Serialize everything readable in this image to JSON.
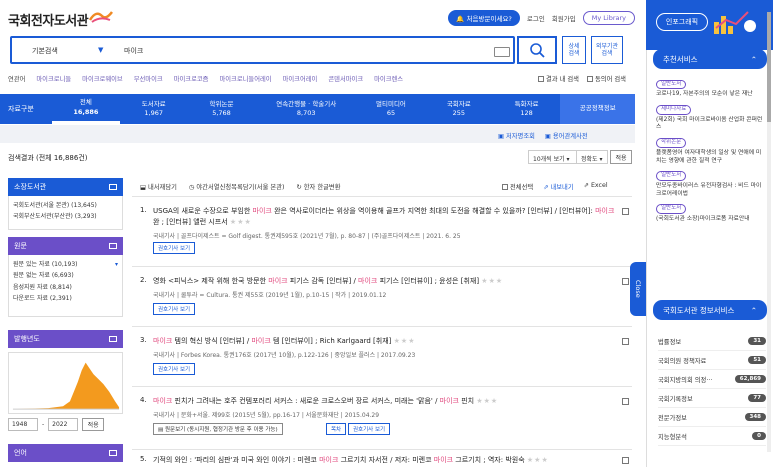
{
  "header": {
    "logo_text": "국회전자도서관",
    "first_visit": "처음방문이세요?",
    "login": "로그인",
    "signup": "회원가입",
    "my_library": "My Library"
  },
  "search": {
    "type": "기본검색",
    "query": "마이크",
    "detail_label": "상세\n검색",
    "external_label": "외부기관\n검색"
  },
  "related": {
    "label": "연관어",
    "terms": [
      "마이크로니들",
      "마이크로웨이브",
      "무선마이크",
      "마이크로코즘",
      "마이크로니들어레이",
      "마이크어레이",
      "콘덴서마이크",
      "마이크렌스"
    ],
    "within_results": "결과 내 검색",
    "synonyms": "동의어 검색"
  },
  "tabs": {
    "label": "자료구분",
    "items": [
      {
        "name": "전체",
        "count": "16,886"
      },
      {
        "name": "도서자료",
        "count": "1,967"
      },
      {
        "name": "학위논문",
        "count": "5,768"
      },
      {
        "name": "연속간행물 · 학술기사",
        "count": "8,703"
      },
      {
        "name": "멀티미디어",
        "count": "65"
      },
      {
        "name": "국회자료",
        "count": "255"
      },
      {
        "name": "특화자료",
        "count": "128"
      }
    ],
    "policy": "공공정책정보"
  },
  "sub_links": {
    "help": "저자명조회",
    "dict": "용어관계사전"
  },
  "results": {
    "title": "검색결과 (전체 16,886건)",
    "per_page": "10개씩 보기",
    "sort": "정확도",
    "apply": "적용",
    "tools": {
      "page": "내서재담기",
      "basket": "야간서열신청목록담기(서울 본관)",
      "convert": "한자 한글변환"
    },
    "tools_right": {
      "select_all": "전체선택",
      "save": "내보내기",
      "excel": "Excel"
    },
    "items": [
      {
        "num": "1.",
        "pre": "USGA의 새로운 수장으로 부임한 ",
        "hl1": "마이크",
        "mid": " 완은 역사로이더라는 위상을 역이용해 골프가 지역한 최대의 도전을 해결할 수 있을까? [인터뷰] / [인터뷰어]: ",
        "hl2": "마이크",
        "post": " 완 ; [인터뷰] 앨런 시프서",
        "stars": "★★★",
        "meta": "국내기사 | 골프다이제스트 = Golf digest. 통권제595호 (2021년 7월), p. 80-87 | (주)골프다이제스트 | 2021. 6. 25",
        "button": "권호기사 보기"
      },
      {
        "num": "2.",
        "pre": "영화 <피닉스> 제작 위해 한국 방문한 ",
        "hl1": "마이크",
        "mid": " 피기스 감독 [인터뷰] / ",
        "hl2": "마이크",
        "post": " 피기스 [인터뷰이] ; 윤성은 [취재]",
        "stars": "★★★",
        "meta": "국내기사 | 쿨투라 = Cultura. 통권 제55호 (2019년 1월), p.10-15 | 작가 | 2019.01.12",
        "button": "권호기사 보기"
      },
      {
        "num": "3.",
        "pre": "",
        "hl1": "마이크",
        "mid": " 템의 혁신 방식 [인터뷰] / ",
        "hl2": "마이크",
        "post": " 템 [인터뷰이] ; Rich Karlgaard [취재]",
        "stars": "★★★",
        "meta": "국내기사 | Forbes Korea. 통권176호 (2017년 10월), p.122-126 | 중앙일보 플러스 | 2017.09.23",
        "button": "권호기사 보기"
      },
      {
        "num": "4.",
        "pre": "",
        "hl1": "마이크",
        "mid": " 핀치가 그려내는 호주 컨템포러리 서커스 : 새로운 크로스오버 장르 서커스, 미래는 '맑음' / ",
        "hl2": "마이크",
        "post": " 핀치",
        "stars": "★★★",
        "meta": "국내기사 | 문화+서울. 제99호 (2015년 5월), pp.16-17 | 서울문화재단 | 2015.04.29",
        "extra": "원문보기 (동시지원, 협정기관 방문 후 이용 가능)",
        "toc": "목차",
        "button": "권호기사 보기"
      },
      {
        "num": "5.",
        "pre": "기적의 와인 : '파리의 심판'과 미국 와인 이야기 : 미렌코 ",
        "hl1": "마이크",
        "mid": " 그르기치 자서전 / 저자: 미렌코 ",
        "hl2": "마이크",
        "post": " 그르기치 ; 역자: 박원숙",
        "stars": "★★★"
      }
    ]
  },
  "facets": {
    "library": {
      "title": "소장도서관",
      "items": [
        "국회도서관(서울 본관) (13,645)",
        "국회부산도서관(부산관) (3,293)"
      ]
    },
    "fulltext": {
      "title": "원문",
      "items": [
        "원문 있는 자료 (10,193)",
        "원문 없는 자료 (6,693)",
        "음성지원 자료 (8,814)",
        "다운로드 자료 (2,391)"
      ]
    },
    "year": {
      "title": "발행년도",
      "from": "1948",
      "to": "2022",
      "apply": "적용"
    },
    "lang": {
      "title": "언어"
    }
  },
  "right_panel": {
    "infographic": "인포그래픽",
    "recommend_title": "추천서비스",
    "recommend": [
      {
        "tag": "일반도서",
        "text": "코로나19, 자본주의의 모순이 낳은 재난"
      },
      {
        "tag": "세미나자료",
        "text": "(제2회) 국회 마이크로바이옴 산업화 콘퍼런스"
      },
      {
        "tag": "학위논문",
        "text": "플랫폼영어 여자대학생의 일상 및 연애에 미치는 영향에 관한 질적 연구"
      },
      {
        "tag": "일반도서",
        "text": "만모두종바이러스 유전자형검사 : 비드 마이크로어레이법"
      },
      {
        "tag": "일반도서",
        "text": "(국회도서관 소장)마이크로폼 자료안내"
      }
    ],
    "service_title": "국회도서관 정보서비스",
    "services": [
      {
        "name": "법률정보",
        "count": "31"
      },
      {
        "name": "국회의원 정책자료",
        "count": "51"
      },
      {
        "name": "국회지방의회 의정···",
        "count": "62,869"
      },
      {
        "name": "국회기록정보",
        "count": "77"
      },
      {
        "name": "전문가정보",
        "count": "348"
      },
      {
        "name": "지능형분석",
        "count": "0"
      }
    ],
    "close": "Close"
  },
  "colors": {
    "primary": "#1a5bd6",
    "highlight": "#e0457b",
    "purple": "#6b4fc8"
  }
}
